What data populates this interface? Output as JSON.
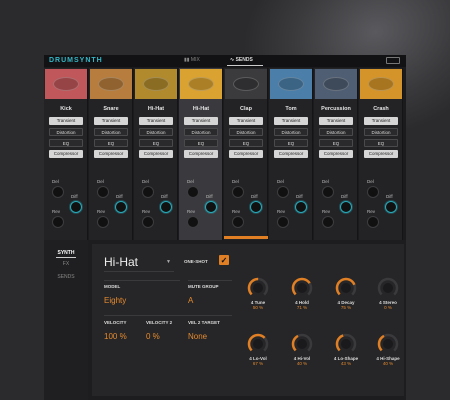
{
  "app": {
    "logo": "DRUMSYNTH",
    "tab_mix": "MIX",
    "tab_sends": "SENDS"
  },
  "channels": [
    {
      "name": "Kick",
      "color": "#c0575a"
    },
    {
      "name": "Snare",
      "color": "#b77d3e"
    },
    {
      "name": "Hi-Hat",
      "color": "#b08a2d"
    },
    {
      "name": "Hi-Hat",
      "color": "#d9a231"
    },
    {
      "name": "Clap",
      "color": "#3b3b3d"
    },
    {
      "name": "Tom",
      "color": "#4b7ea8"
    },
    {
      "name": "Percussion",
      "color": "#4f5e72"
    },
    {
      "name": "Crash",
      "color": "#d49429"
    }
  ],
  "fx": {
    "transient": "Transient",
    "distortion": "Distortion",
    "eq": "EQ",
    "compressor": "Compressor"
  },
  "knobs": {
    "del": "Del",
    "diff": "Diff",
    "rev": "Rev"
  },
  "lower": {
    "tab_synth": "SYNTH",
    "tab_fx": "FX",
    "tab_sends": "SENDS",
    "instrument": "Hi-Hat",
    "one_shot": "ONE-SHOT",
    "model_label": "MODEL",
    "model_value": "Eighty",
    "mute_label": "MUTE GROUP",
    "mute_value": "A",
    "velocity_label": "VELOCITY",
    "velocity_value": "100 %",
    "velocity2_label": "VELOCITY 2",
    "velocity2_value": "0 %",
    "vel2target_label": "VEL 2 TARGET",
    "vel2target_value": "None"
  },
  "big_knobs": [
    {
      "name": "4 Tune",
      "value": "50 %"
    },
    {
      "name": "4 Hold",
      "value": "71 %"
    },
    {
      "name": "4 Decay",
      "value": "75 %"
    },
    {
      "name": "4 Stereo",
      "value": "0 %"
    },
    {
      "name": "4 Lo-Vol",
      "value": "67 %"
    },
    {
      "name": "4 Hi-Vol",
      "value": "40 %"
    },
    {
      "name": "4 Lo-Shape",
      "value": "43 %"
    },
    {
      "name": "4 Hi-Shape",
      "value": "40 %"
    }
  ],
  "colors": {
    "accent": "#e07f23",
    "teal": "#27a9b8"
  }
}
